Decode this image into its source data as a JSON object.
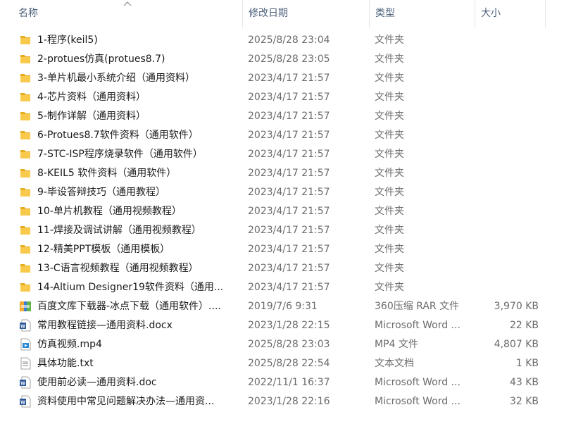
{
  "header": {
    "name": "名称",
    "date": "修改日期",
    "type": "类型",
    "size": "大小"
  },
  "files": [
    {
      "name": "1-程序(keil5)",
      "date": "2025/8/28 23:04",
      "type": "文件夹",
      "size": "",
      "icon": "folder-icon"
    },
    {
      "name": "2-protues仿真(protues8.7)",
      "date": "2025/8/28 23:05",
      "type": "文件夹",
      "size": "",
      "icon": "folder-icon"
    },
    {
      "name": "3-单片机最小系统介绍（通用资料）",
      "date": "2023/4/17 21:57",
      "type": "文件夹",
      "size": "",
      "icon": "folder-icon"
    },
    {
      "name": "4-芯片资料（通用资料）",
      "date": "2023/4/17 21:57",
      "type": "文件夹",
      "size": "",
      "icon": "folder-icon"
    },
    {
      "name": "5-制作详解（通用资料）",
      "date": "2023/4/17 21:57",
      "type": "文件夹",
      "size": "",
      "icon": "folder-icon"
    },
    {
      "name": "6-Protues8.7软件资料（通用软件）",
      "date": "2023/4/17 21:57",
      "type": "文件夹",
      "size": "",
      "icon": "folder-icon"
    },
    {
      "name": "7-STC-ISP程序烧录软件（通用软件）",
      "date": "2023/4/17 21:57",
      "type": "文件夹",
      "size": "",
      "icon": "folder-icon"
    },
    {
      "name": "8-KEIL5 软件资料（通用软件）",
      "date": "2023/4/17 21:57",
      "type": "文件夹",
      "size": "",
      "icon": "folder-icon"
    },
    {
      "name": "9-毕设答辩技巧（通用教程）",
      "date": "2023/4/17 21:57",
      "type": "文件夹",
      "size": "",
      "icon": "folder-icon"
    },
    {
      "name": "10-单片机教程（通用视频教程）",
      "date": "2023/4/17 21:57",
      "type": "文件夹",
      "size": "",
      "icon": "folder-icon"
    },
    {
      "name": "11-焊接及调试讲解（通用视频教程）",
      "date": "2023/4/17 21:57",
      "type": "文件夹",
      "size": "",
      "icon": "folder-icon"
    },
    {
      "name": "12-精美PPT模板（通用模板）",
      "date": "2023/4/17 21:57",
      "type": "文件夹",
      "size": "",
      "icon": "folder-icon"
    },
    {
      "name": "13-C语言视频教程（通用视频教程）",
      "date": "2023/4/17 21:57",
      "type": "文件夹",
      "size": "",
      "icon": "folder-icon"
    },
    {
      "name": "14-Altium Designer19软件资料（通用...",
      "date": "2023/4/17 21:57",
      "type": "文件夹",
      "size": "",
      "icon": "folder-icon"
    },
    {
      "name": "百度文库下载器-冰点下载（通用软件）....",
      "date": "2019/7/6 9:31",
      "type": "360压缩 RAR 文件",
      "size": "3,970 KB",
      "icon": "rar-archive-icon"
    },
    {
      "name": "常用教程链接—通用资料.docx",
      "date": "2023/1/28 22:15",
      "type": "Microsoft Word ...",
      "size": "22 KB",
      "icon": "word-document-icon"
    },
    {
      "name": "仿真视频.mp4",
      "date": "2025/8/28 23:03",
      "type": "MP4 文件",
      "size": "4,807 KB",
      "icon": "video-file-icon"
    },
    {
      "name": "具体功能.txt",
      "date": "2025/8/28 22:54",
      "type": "文本文档",
      "size": "1 KB",
      "icon": "text-file-icon"
    },
    {
      "name": "使用前必读—通用资料.doc",
      "date": "2022/11/1 16:37",
      "type": "Microsoft Word ...",
      "size": "43 KB",
      "icon": "word-document-icon"
    },
    {
      "name": "资料使用中常见问题解决办法—通用资...",
      "date": "2023/1/28 22:16",
      "type": "Microsoft Word ...",
      "size": "32 KB",
      "icon": "word-document-icon"
    }
  ],
  "colors": {
    "header_text": "#4c607a",
    "folder": "#f8c94a",
    "folder_dark": "#e5ac1e",
    "word_blue": "#2b579a"
  }
}
